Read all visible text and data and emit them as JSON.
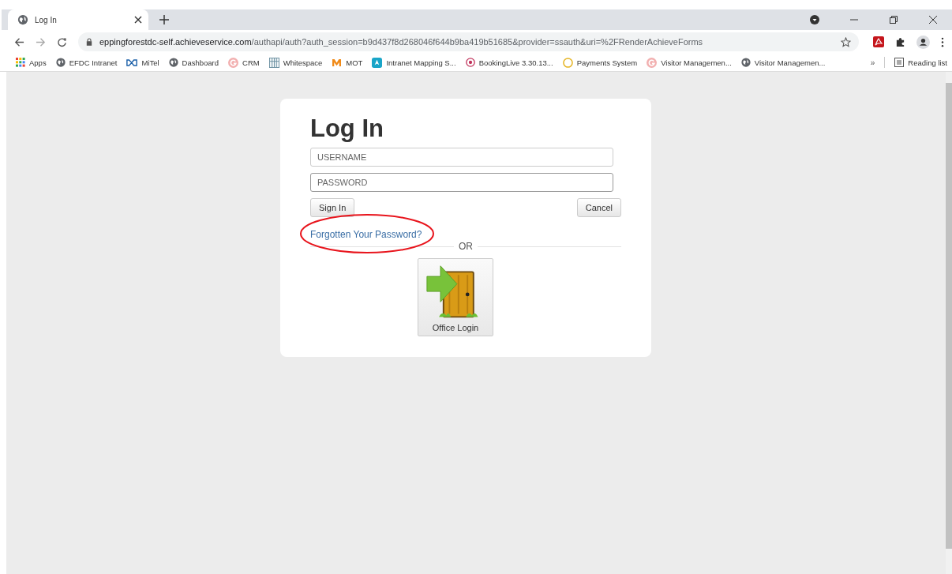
{
  "tabs": [
    {
      "title": "Log In",
      "selected": true
    }
  ],
  "address": {
    "host": "eppingforestdc-self.achieveservice.com",
    "path": "/authapi/auth?auth_session=b9d437f8d268046f644b9ba419b51685&provider=ssauth&uri=%2FRenderAchieveForms"
  },
  "bookmarks": [
    {
      "label": "Apps",
      "kind": "apps"
    },
    {
      "label": "EFDC Intranet",
      "kind": "globe"
    },
    {
      "label": "MiTel",
      "kind": "mitel"
    },
    {
      "label": "Dashboard",
      "kind": "globe"
    },
    {
      "label": "CRM",
      "kind": "g-logo"
    },
    {
      "label": "Whitespace",
      "kind": "grid"
    },
    {
      "label": "MOT",
      "kind": "m-logo"
    },
    {
      "label": "Intranet Mapping S...",
      "kind": "mapping"
    },
    {
      "label": "BookingLive 3.30.13...",
      "kind": "booking"
    },
    {
      "label": "Payments System",
      "kind": "ring"
    },
    {
      "label": "Visitor Managemen...",
      "kind": "g-logo"
    },
    {
      "label": "Visitor Managemen...",
      "kind": "globe"
    }
  ],
  "more_bookmarks": "»",
  "reading_list": "Reading list",
  "login": {
    "title": "Log In",
    "username_placeholder": "USERNAME",
    "password_placeholder": "PASSWORD",
    "sign_in": "Sign In",
    "cancel": "Cancel",
    "forgot_link": "Forgotten Your Password?",
    "forgot_highlighted": true,
    "divider": "OR",
    "office_login": "Office Login"
  }
}
